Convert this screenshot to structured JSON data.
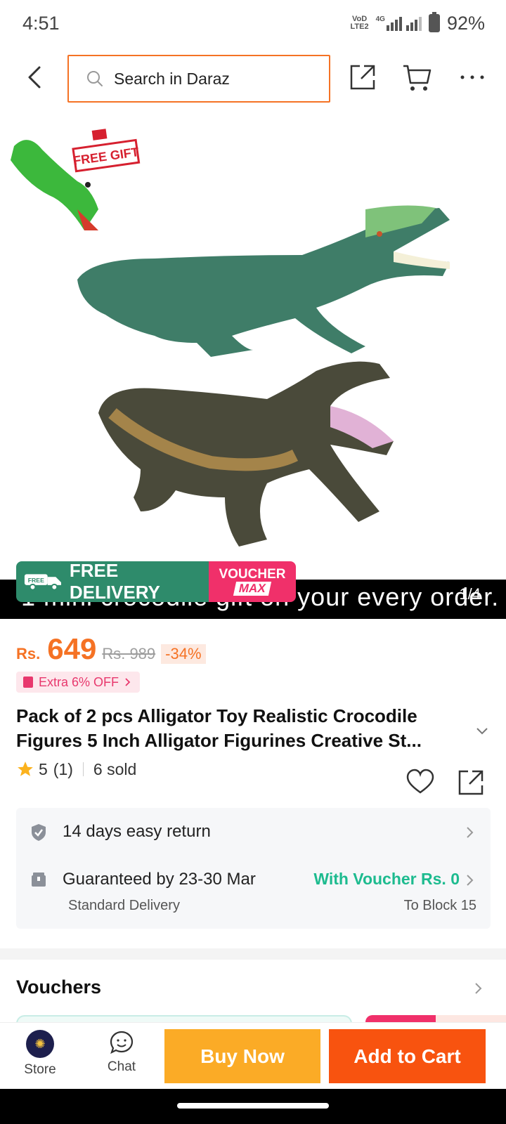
{
  "status_bar": {
    "time": "4:51",
    "network_top": "VoD",
    "network_bottom": "LTE2",
    "gen": "4G",
    "battery": "92%"
  },
  "header": {
    "search_placeholder": "Search in Daraz"
  },
  "gallery": {
    "free_gift_label": "FREE GIFT",
    "caption": "1 mini crocodile gift on your every order.",
    "page_indicator": "1/4",
    "free_delivery": "FREE DELIVERY",
    "voucher_top": "VOUCHER",
    "voucher_bottom": "MAX"
  },
  "price": {
    "currency": "Rs.",
    "current": "649",
    "original": "Rs. 989",
    "discount": "-34%",
    "extra_offer": "Extra 6% OFF"
  },
  "product": {
    "title": "Pack of 2 pcs Alligator Toy Realistic Crocodile Figures 5 Inch Alligator Figurines Creative St...",
    "rating": "5",
    "rating_count": "(1)",
    "sold": "6 sold"
  },
  "services": {
    "return_policy": "14 days easy return",
    "delivery_guarantee": "Guaranteed by 23-30 Mar",
    "delivery_voucher": "With Voucher Rs. 0",
    "delivery_type": "Standard Delivery",
    "delivery_location": "To Block 15"
  },
  "vouchers": {
    "title": "Vouchers"
  },
  "action_bar": {
    "store_label": "Store",
    "chat_label": "Chat",
    "buy_now": "Buy Now",
    "add_to_cart": "Add to Cart"
  },
  "colors": {
    "accent": "#f57224",
    "buy_now": "#fbab26",
    "add_to_cart": "#f8530f",
    "voucher_green": "#1dbb8f",
    "free_delivery": "#2e8b6b",
    "voucher_pink": "#f0306a"
  }
}
